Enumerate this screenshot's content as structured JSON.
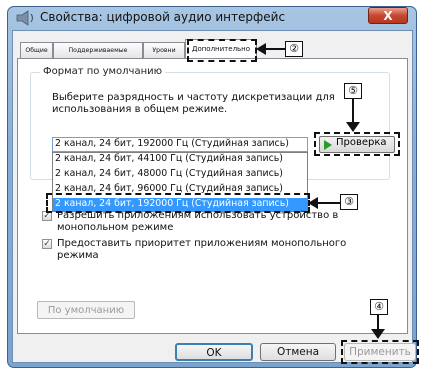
{
  "window": {
    "title": "Свойства: цифровой аудио интерфейс",
    "close_label": "X"
  },
  "tabs": [
    {
      "label": "Общие"
    },
    {
      "label": "Поддерживаемые форматы"
    },
    {
      "label": "Уровни"
    },
    {
      "label": "Дополнительно"
    }
  ],
  "default_format": {
    "group_title": "Формат по умолчанию",
    "description_line1": "Выберите разрядность и частоту дискретизации для",
    "description_line2": "использования в общем режиме.",
    "selected_value": "2 канал, 24 бит, 192000 Гц (Студийная запись)",
    "options": [
      "2 канал, 24 бит, 44100 Гц (Студийная запись)",
      "2 канал, 24 бит, 48000 Гц (Студийная запись)",
      "2 канал, 24 бит, 96000 Гц (Студийная запись)",
      "2 канал, 24 бит, 192000 Гц (Студийная запись)"
    ],
    "test_button": "Проверка"
  },
  "exclusive_mode": {
    "allow_line1": "Разрешить приложениям использовать устройство в",
    "allow_line2": "монопольном режиме",
    "priority_line1": "Предоставить приоритет приложениям монопольного",
    "priority_line2": "режима"
  },
  "buttons": {
    "defaults": "По умолчанию",
    "ok": "OK",
    "cancel": "Отмена",
    "apply": "Применить"
  },
  "callouts": {
    "two": "②",
    "three": "③",
    "four": "④",
    "five": "⑤"
  }
}
